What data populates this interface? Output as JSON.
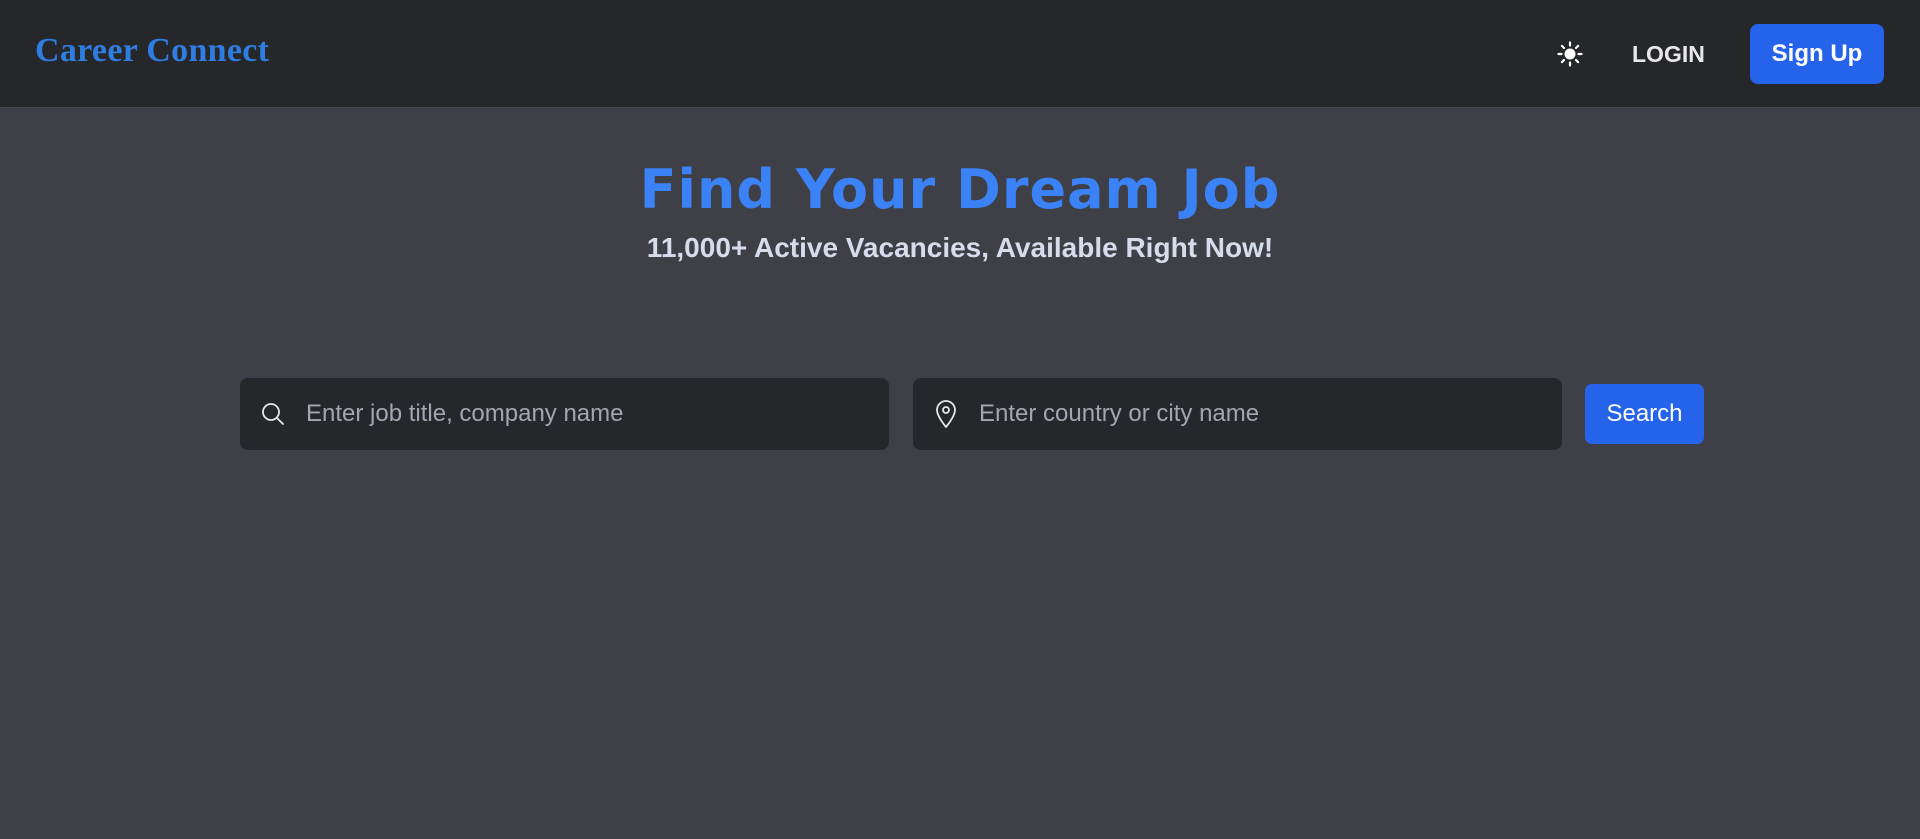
{
  "header": {
    "logo_text": "Career Connect",
    "theme_icon": "sun-icon",
    "login_label": "LOGIN",
    "signup_label": "Sign Up"
  },
  "hero": {
    "title": "Find Your Dream Job",
    "subtitle": "11,000+ Active Vacancies, Available Right Now!"
  },
  "search": {
    "job_icon": "search-icon",
    "job_placeholder": "Enter job title, company name",
    "job_value": "",
    "location_icon": "map-pin-icon",
    "location_placeholder": "Enter country or city name",
    "location_value": "",
    "button_label": "Search"
  },
  "colors": {
    "page_background": "#3f4047",
    "header_background": "#26272b",
    "brand_blue": "#2f7de0",
    "accent": "#2563eb",
    "title_blue": "#3b82f6"
  }
}
